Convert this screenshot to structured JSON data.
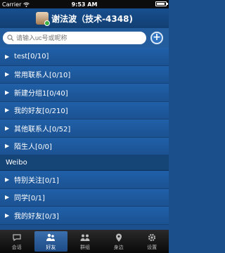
{
  "status": {
    "carrier": "Carrier",
    "time": "9:53 AM",
    "battery_level": 0.9
  },
  "header": {
    "title": "谢法波（技术-4348)"
  },
  "search": {
    "placeholder": "请输入uc号或昵称"
  },
  "groups": [
    {
      "label": "test[0/10]"
    },
    {
      "label": "常用联系人[0/10]"
    },
    {
      "label": "新建分组1[0/40]"
    },
    {
      "label": "我的好友[0/210]"
    },
    {
      "label": "其他联系人[0/52]"
    },
    {
      "label": "陌生人[0/0]"
    }
  ],
  "weibo": {
    "header": "Weibo",
    "groups": [
      {
        "label": "特别关注[0/1]"
      },
      {
        "label": "同学[0/1]"
      },
      {
        "label": "我的好友[0/3]"
      }
    ]
  },
  "tabs": [
    {
      "label": "会话",
      "icon": "chat-icon"
    },
    {
      "label": "好友",
      "icon": "friends-icon"
    },
    {
      "label": "群组",
      "icon": "group-icon"
    },
    {
      "label": "身边",
      "icon": "location-icon"
    },
    {
      "label": "设置",
      "icon": "gear-icon"
    }
  ],
  "colors": {
    "nav": "#174f8f",
    "list": "#1c4f8d",
    "tab_active": "#3b6fae"
  }
}
